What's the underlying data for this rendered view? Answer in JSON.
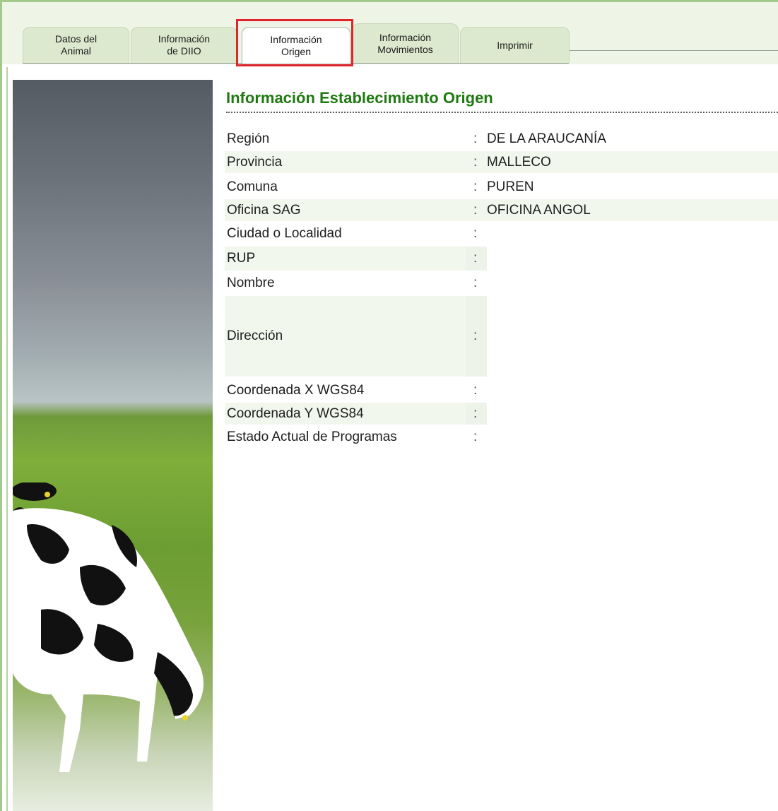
{
  "tabs": [
    {
      "label": "Datos del\nAnimal",
      "active": false
    },
    {
      "label": "Información\nde DIIO",
      "active": false
    },
    {
      "label": "Información\nOrigen",
      "active": true
    },
    {
      "label": "Información\nMovimientos",
      "active": false
    },
    {
      "label": "Imprimir",
      "active": false
    }
  ],
  "section": {
    "title": "Información Establecimiento Origen",
    "separator": ":",
    "fields": [
      {
        "label": "Región",
        "value": "DE LA ARAUCANÍA"
      },
      {
        "label": "Provincia",
        "value": "MALLECO"
      },
      {
        "label": "Comuna",
        "value": "PUREN"
      },
      {
        "label": "Oficina SAG",
        "value": "OFICINA ANGOL"
      },
      {
        "label": "Ciudad o Localidad",
        "value": ""
      },
      {
        "label": "RUP",
        "value": ""
      },
      {
        "label": "Nombre",
        "value": ""
      },
      {
        "label": "Dirección",
        "value": ""
      },
      {
        "label": "Coordenada X WGS84",
        "value": ""
      },
      {
        "label": "Coordenada Y WGS84",
        "value": ""
      },
      {
        "label": "Estado Actual de Programas",
        "value": ""
      }
    ]
  },
  "colors": {
    "accent_green": "#1f7a12",
    "tab_fill": "#dde9cf",
    "highlight_red": "#e1232c"
  },
  "side_image": {
    "subject": "holstein-cows-grazing"
  }
}
